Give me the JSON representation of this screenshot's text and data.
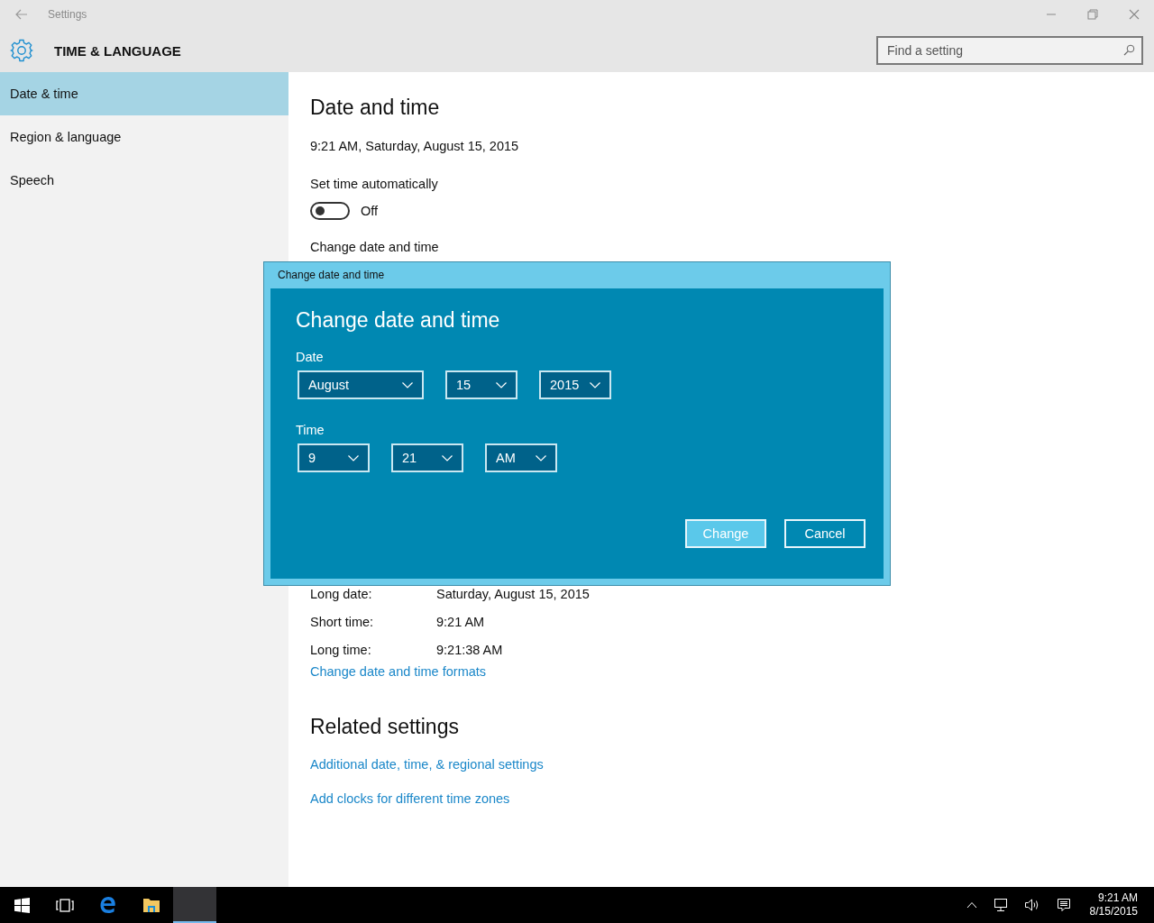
{
  "window": {
    "title": "Settings"
  },
  "header": {
    "title": "TIME & LANGUAGE",
    "search": {
      "placeholder": "Find a setting"
    }
  },
  "sidebar": {
    "items": [
      {
        "label": "Date & time",
        "selected": true
      },
      {
        "label": "Region & language",
        "selected": false
      },
      {
        "label": "Speech",
        "selected": false
      }
    ]
  },
  "content": {
    "title": "Date and time",
    "current": "9:21 AM, Saturday, August 15, 2015",
    "auto_time": {
      "label": "Set time automatically",
      "on": false,
      "state_text": "Off"
    },
    "change_label": "Change date and time",
    "formats": [
      {
        "label": "Long date:",
        "value": "Saturday, August 15, 2015"
      },
      {
        "label": "Short time:",
        "value": "9:21 AM"
      },
      {
        "label": "Long time:",
        "value": "9:21:38 AM"
      }
    ],
    "formats_link": "Change date and time formats",
    "related": {
      "title": "Related settings",
      "links": [
        "Additional date, time, & regional settings",
        "Add clocks for different time zones"
      ]
    }
  },
  "dialog": {
    "window_title": "Change date and time",
    "heading": "Change date and time",
    "sections": [
      {
        "label": "Date",
        "fields": [
          "August",
          "15",
          "2015"
        ]
      },
      {
        "label": "Time",
        "fields": [
          "9",
          "21",
          "AM"
        ]
      }
    ],
    "buttons": [
      {
        "label": "Change",
        "kind": "primary"
      },
      {
        "label": "Cancel",
        "kind": "secondary"
      }
    ]
  },
  "taskbar": {
    "apps": [
      {
        "kind": "start",
        "selected": false
      },
      {
        "kind": "task-view",
        "selected": false
      },
      {
        "kind": "browser",
        "selected": false
      },
      {
        "kind": "folder",
        "selected": false
      },
      {
        "kind": "window",
        "selected": true
      }
    ],
    "clock": {
      "time": "9:21 AM",
      "date": "8/15/2015"
    }
  }
}
